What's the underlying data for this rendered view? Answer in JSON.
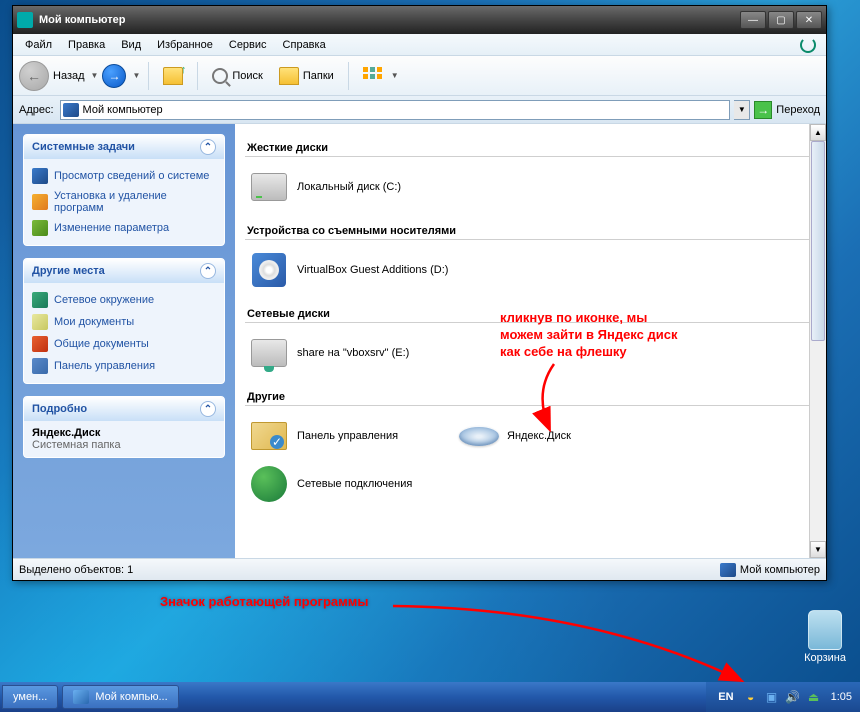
{
  "window": {
    "title": "Мой компьютер"
  },
  "menubar": [
    "Файл",
    "Правка",
    "Вид",
    "Избранное",
    "Сервис",
    "Справка"
  ],
  "toolbar": {
    "back": "Назад",
    "search": "Поиск",
    "folders": "Папки"
  },
  "addressbar": {
    "label": "Адрес:",
    "value": "Мой компьютер",
    "go": "Переход"
  },
  "sidebar": {
    "tasks": {
      "title": "Системные задачи",
      "items": [
        "Просмотр сведений о системе",
        "Установка и удаление программ",
        "Изменение параметра"
      ]
    },
    "places": {
      "title": "Другие места",
      "items": [
        "Сетевое окружение",
        "Мои документы",
        "Общие документы",
        "Панель управления"
      ]
    },
    "details": {
      "title": "Подробно",
      "name": "Яндекс.Диск",
      "type": "Системная папка"
    }
  },
  "content": {
    "groups": [
      {
        "title": "Жесткие диски",
        "items": [
          {
            "label": "Локальный диск (C:)",
            "icon": "hdd"
          }
        ]
      },
      {
        "title": "Устройства со съемными носителями",
        "items": [
          {
            "label": "VirtualBox Guest Additions (D:)",
            "icon": "cd"
          }
        ]
      },
      {
        "title": "Сетевые диски",
        "items": [
          {
            "label": "share на \"vboxsrv\" (E:)",
            "icon": "netd"
          }
        ]
      },
      {
        "title": "Другие",
        "items": [
          {
            "label": "Панель управления",
            "icon": "cp"
          },
          {
            "label": "Яндекс.Диск",
            "icon": "ydisk"
          },
          {
            "label": "Сетевые подключения",
            "icon": "net"
          }
        ]
      }
    ]
  },
  "statusbar": {
    "left": "Выделено объектов: 1",
    "right": "Мой компьютер"
  },
  "annotations": {
    "note1": "кликнув по иконке, мы можем зайти в Яндекс диск как себе на флешку",
    "note2": "Значок работающей программы"
  },
  "desktop": {
    "recycle": "Корзина"
  },
  "taskbar": {
    "buttons": [
      "умен...",
      "Мой компью..."
    ],
    "lang": "EN",
    "clock": "1:05"
  }
}
